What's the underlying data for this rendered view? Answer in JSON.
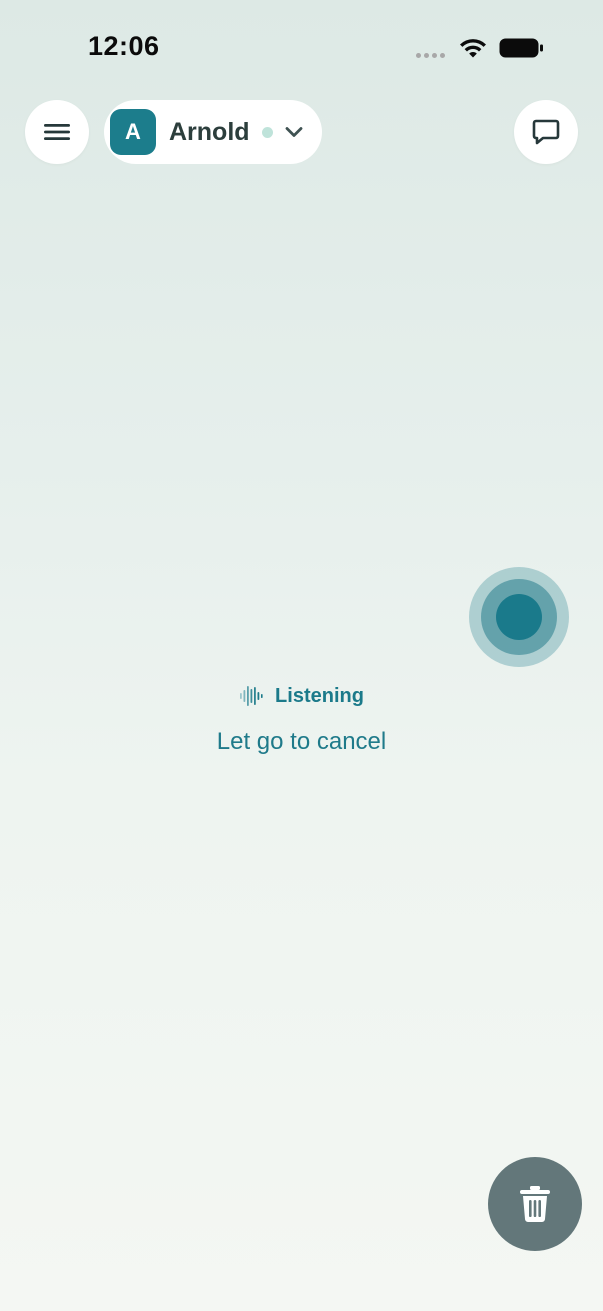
{
  "status_bar": {
    "time": "12:06",
    "wifi_icon": "wifi-icon",
    "battery_icon": "battery-icon",
    "signal_icon": "signal-dots-icon"
  },
  "header": {
    "menu_icon": "hamburger-menu-icon",
    "profile": {
      "avatar_letter": "A",
      "name": "Arnold",
      "status_color": "#bfe3da",
      "chevron_icon": "chevron-down-icon"
    },
    "chat_icon": "chat-bubble-icon"
  },
  "voice": {
    "status_icon": "sound-wave-icon",
    "status_label": "Listening",
    "hint": "Let go to cancel"
  },
  "actions": {
    "trash_icon": "trash-icon"
  },
  "colors": {
    "accent": "#1c7d8c",
    "trash_bg": "#63777a"
  }
}
